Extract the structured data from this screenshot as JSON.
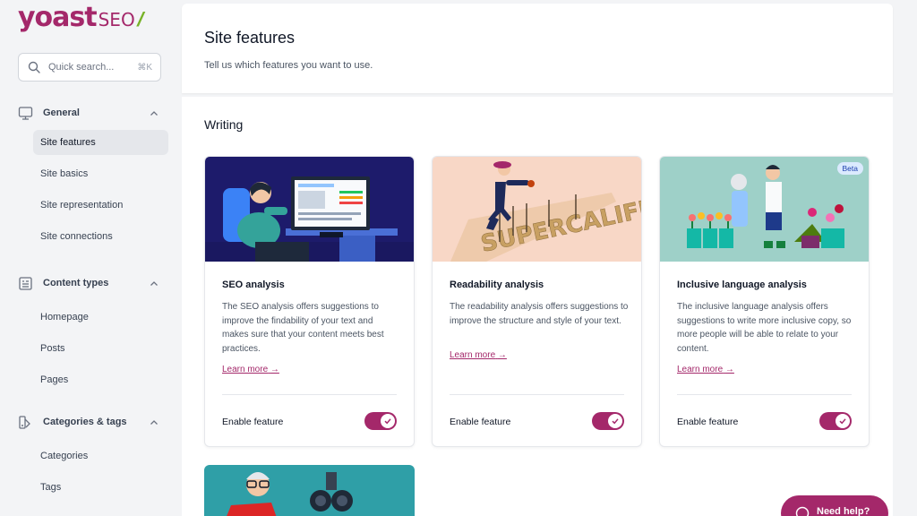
{
  "brand": {
    "name": "yoast",
    "product": "SEO",
    "accent": "#a4286a",
    "slash_color": "#77b227"
  },
  "search": {
    "placeholder": "Quick search...",
    "shortcut": "⌘K"
  },
  "sidebar": {
    "groups": [
      {
        "label": "General",
        "icon": "monitor-icon",
        "items": [
          "Site features",
          "Site basics",
          "Site representation",
          "Site connections"
        ],
        "active": "Site features"
      },
      {
        "label": "Content types",
        "icon": "document-list-icon",
        "items": [
          "Homepage",
          "Posts",
          "Pages"
        ]
      },
      {
        "label": "Categories & tags",
        "icon": "tag-shapes-icon",
        "items": [
          "Categories",
          "Tags"
        ]
      }
    ]
  },
  "header": {
    "title": "Site features",
    "subtitle": "Tell us which features you want to use."
  },
  "section": {
    "title": "Writing"
  },
  "features": [
    {
      "title": "SEO analysis",
      "description": "The SEO analysis offers suggestions to improve the findability of your text and makes sure that your content meets best practices.",
      "link": "Learn more",
      "enable_label": "Enable feature",
      "enabled": true
    },
    {
      "title": "Readability analysis",
      "description": "The readability analysis offers suggestions to improve the structure and style of your text.",
      "link": "Learn more",
      "enable_label": "Enable feature",
      "enabled": true,
      "illustration_text": "SUPERCALIFRAGILISTIC"
    },
    {
      "title": "Inclusive language analysis",
      "description": "The inclusive language analysis offers suggestions to write more inclusive copy, so more people will be able to relate to your content.",
      "link": "Learn more",
      "enable_label": "Enable feature",
      "enabled": true,
      "badge": "Beta"
    }
  ],
  "help": {
    "label": "Need help?"
  }
}
